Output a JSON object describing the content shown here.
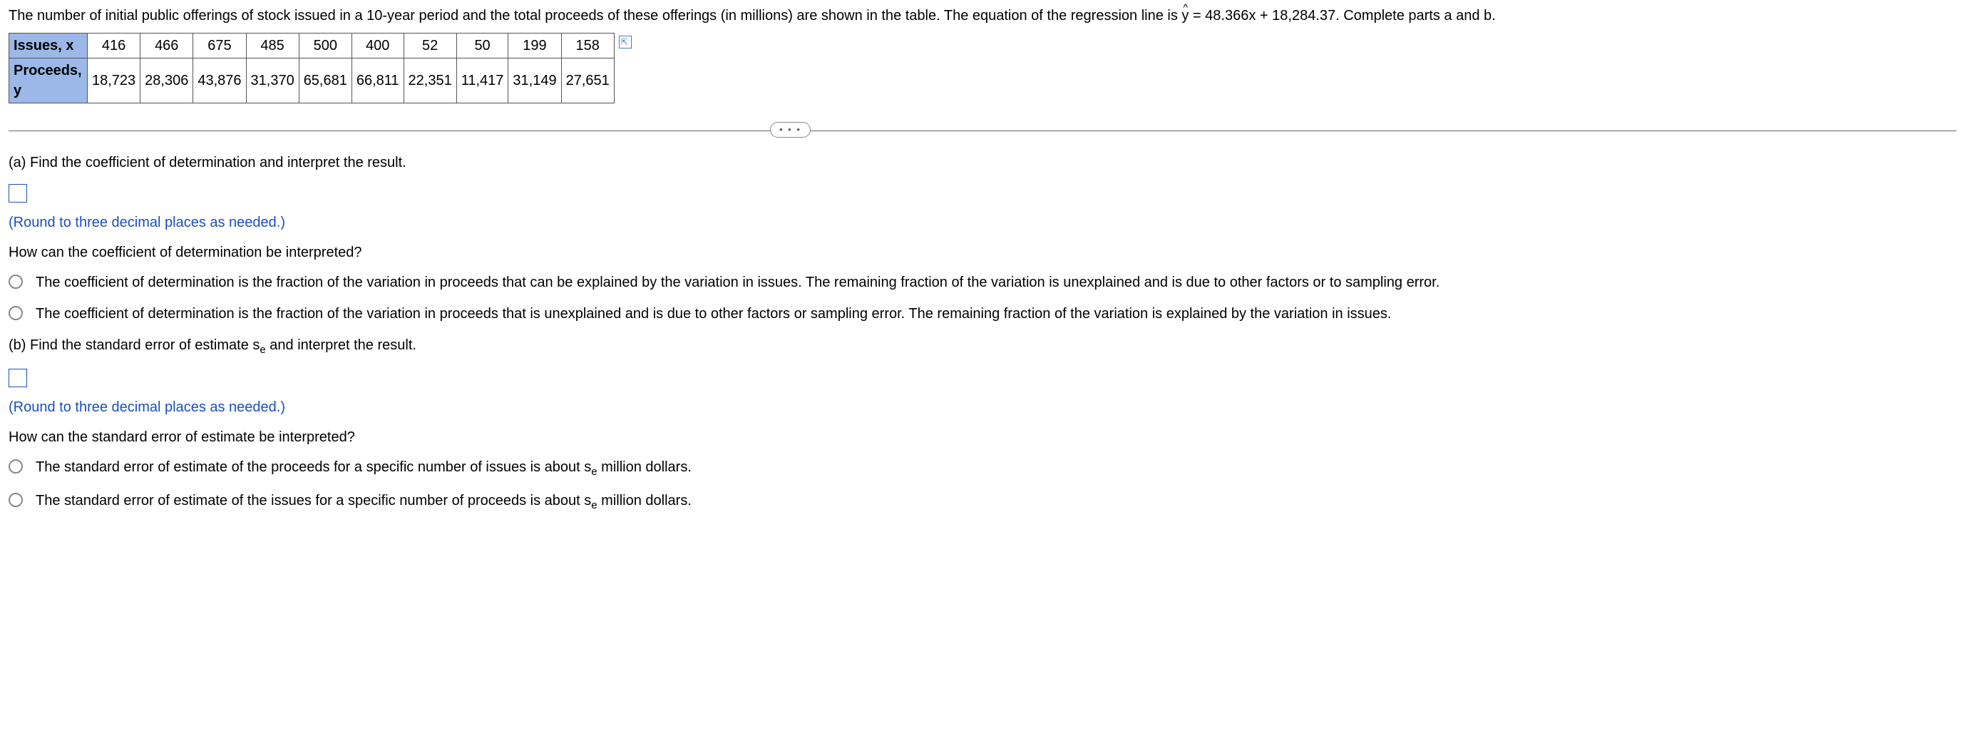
{
  "intro": "The number of initial public offerings of stock issued in a 10-year period and the total proceeds of these offerings (in millions) are shown in the table. The equation of the regression line is ",
  "eqn_prefix": "y",
  "eqn_rest": " = 48.366x + 18,284.37. Complete parts a and b.",
  "table": {
    "row1_label": "Issues, x",
    "row2_label": "Proceeds, y",
    "issues": [
      "416",
      "466",
      "675",
      "485",
      "500",
      "400",
      "52",
      "50",
      "199",
      "158"
    ],
    "proceeds": [
      "18,723",
      "28,306",
      "43,876",
      "31,370",
      "65,681",
      "66,811",
      "22,351",
      "11,417",
      "31,149",
      "27,651"
    ]
  },
  "ellipsis": "…",
  "partA": {
    "prompt": "(a) Find the coefficient of determination and interpret the result.",
    "hint": "(Round to three decimal places as needed.)",
    "interpret_q": "How can the coefficient of determination be interpreted?",
    "opt1": "The coefficient of determination is the fraction of the variation in proceeds that can be explained by the variation in issues. The remaining fraction of the variation is unexplained and is due to other factors or to sampling error.",
    "opt2": "The coefficient of determination is the fraction of the variation in proceeds that is unexplained and is due to other factors or sampling error. The remaining fraction of the variation is explained by the variation in issues."
  },
  "partB": {
    "prompt_pre": "(b) Find the standard error of estimate s",
    "prompt_post": " and interpret the result.",
    "hint": "(Round to three decimal places as needed.)",
    "interpret_q": "How can the standard error of estimate be interpreted?",
    "opt1_pre": "The standard error of estimate of the proceeds for a specific number of issues is about s",
    "opt1_post": " million dollars.",
    "opt2_pre": "The standard error of estimate of the issues for a specific number of proceeds is about s",
    "opt2_post": " million dollars.",
    "sub_e": "e"
  }
}
